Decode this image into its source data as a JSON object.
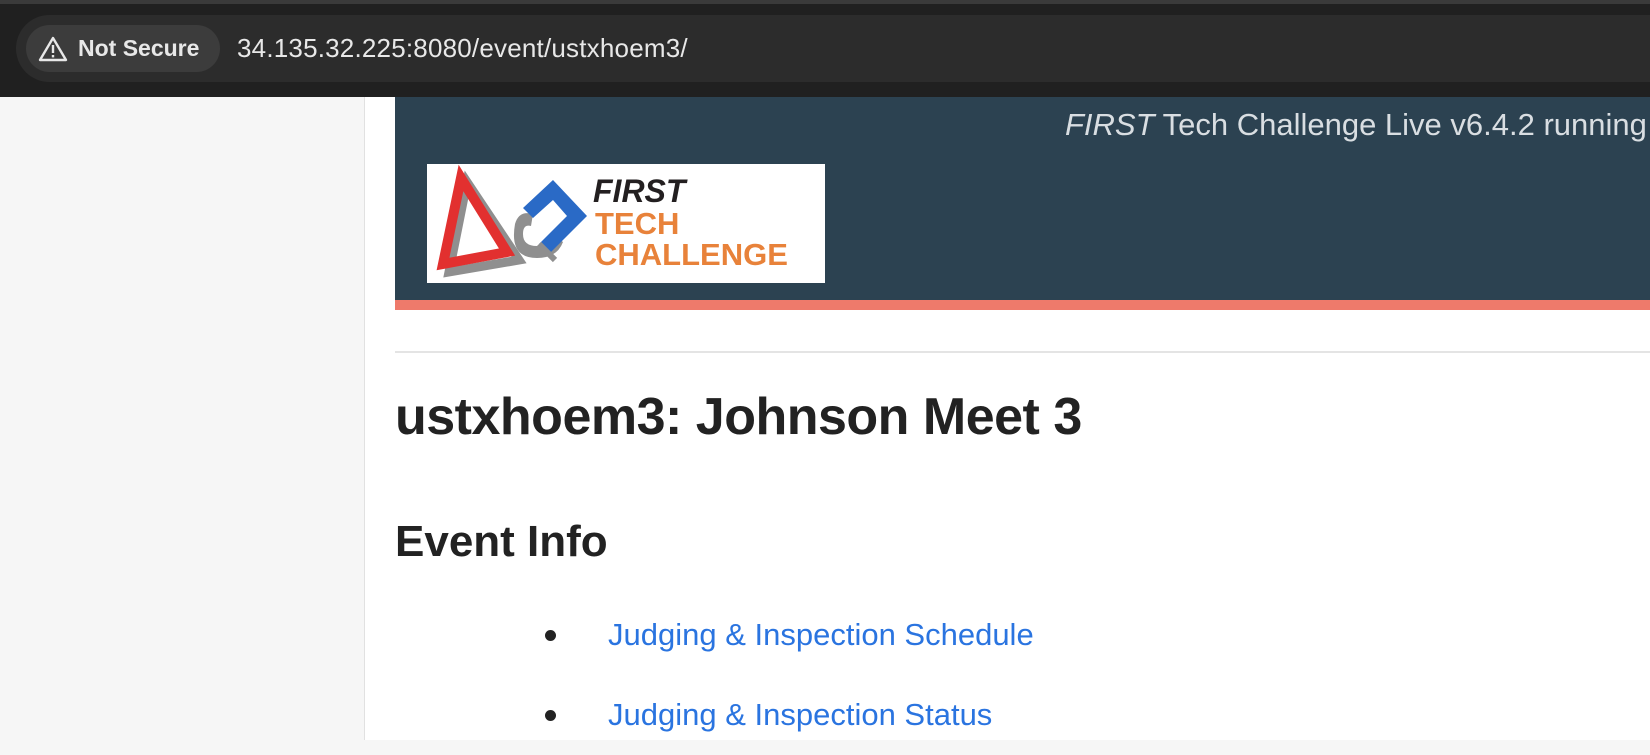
{
  "browser": {
    "security_label": "Not Secure",
    "security_icon": "warning-triangle-icon",
    "url": "34.135.32.225:8080/event/ustxhoem3/"
  },
  "header": {
    "version_first": "FIRST",
    "version_rest": " Tech Challenge Live v6.4.2 running",
    "logo": {
      "first": "FIRST",
      "tech": "TECH",
      "challenge": "CHALLENGE"
    },
    "colors": {
      "background": "#2c4251",
      "rule": "#ee7a6b",
      "logo_orange": "#e8823a",
      "logo_red": "#e2302f",
      "logo_blue": "#2a6ac6"
    }
  },
  "main": {
    "title": "ustxhoem3: Johnson Meet 3",
    "section_heading": "Event Info",
    "links": [
      {
        "label": "Judging & Inspection Schedule"
      },
      {
        "label": "Judging & Inspection Status"
      }
    ],
    "link_color": "#2a74e0"
  }
}
